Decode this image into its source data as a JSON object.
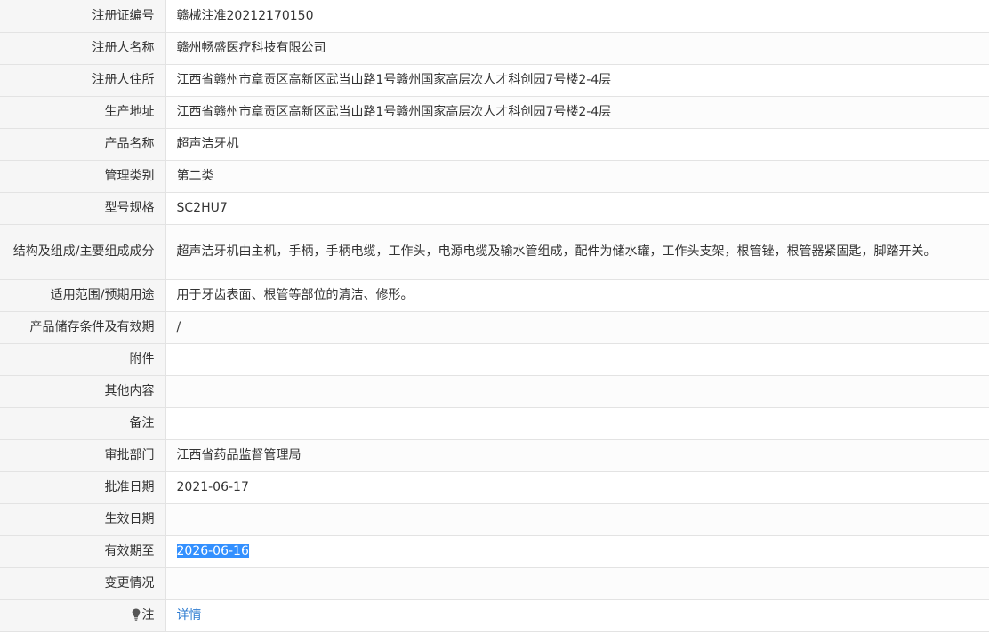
{
  "rows": [
    {
      "label": "注册证编号",
      "value": "赣械注准20212170150"
    },
    {
      "label": "注册人名称",
      "value": "赣州畅盛医疗科技有限公司"
    },
    {
      "label": "注册人住所",
      "value": "江西省赣州市章贡区高新区武当山路1号赣州国家高层次人才科创园7号楼2-4层"
    },
    {
      "label": "生产地址",
      "value": "江西省赣州市章贡区高新区武当山路1号赣州国家高层次人才科创园7号楼2-4层"
    },
    {
      "label": "产品名称",
      "value": "超声洁牙机"
    },
    {
      "label": "管理类别",
      "value": "第二类"
    },
    {
      "label": "型号规格",
      "value": "SC2HU7"
    },
    {
      "label": "结构及组成/主要组成成分",
      "value": "超声洁牙机由主机，手柄，手柄电缆，工作头，电源电缆及输水管组成，配件为储水罐，工作头支架，根管锉，根管器紧固匙，脚踏开关。"
    },
    {
      "label": "适用范围/预期用途",
      "value": "用于牙齿表面、根管等部位的清洁、修形。"
    },
    {
      "label": "产品储存条件及有效期",
      "value": "/"
    },
    {
      "label": "附件",
      "value": ""
    },
    {
      "label": "其他内容",
      "value": ""
    },
    {
      "label": "备注",
      "value": ""
    },
    {
      "label": "审批部门",
      "value": "江西省药品监督管理局"
    },
    {
      "label": "批准日期",
      "value": "2021-06-17"
    },
    {
      "label": "生效日期",
      "value": ""
    },
    {
      "label": "有效期至",
      "value": "2026-06-16"
    },
    {
      "label": "变更情况",
      "value": ""
    }
  ],
  "note": {
    "icon": "lightbulb-icon",
    "label": "注",
    "link_text": "详情"
  },
  "colors": {
    "label_bg": "#f6f6f6",
    "border": "#e3e3e3",
    "link": "#2e7cd1",
    "selection": "#3390ff"
  }
}
